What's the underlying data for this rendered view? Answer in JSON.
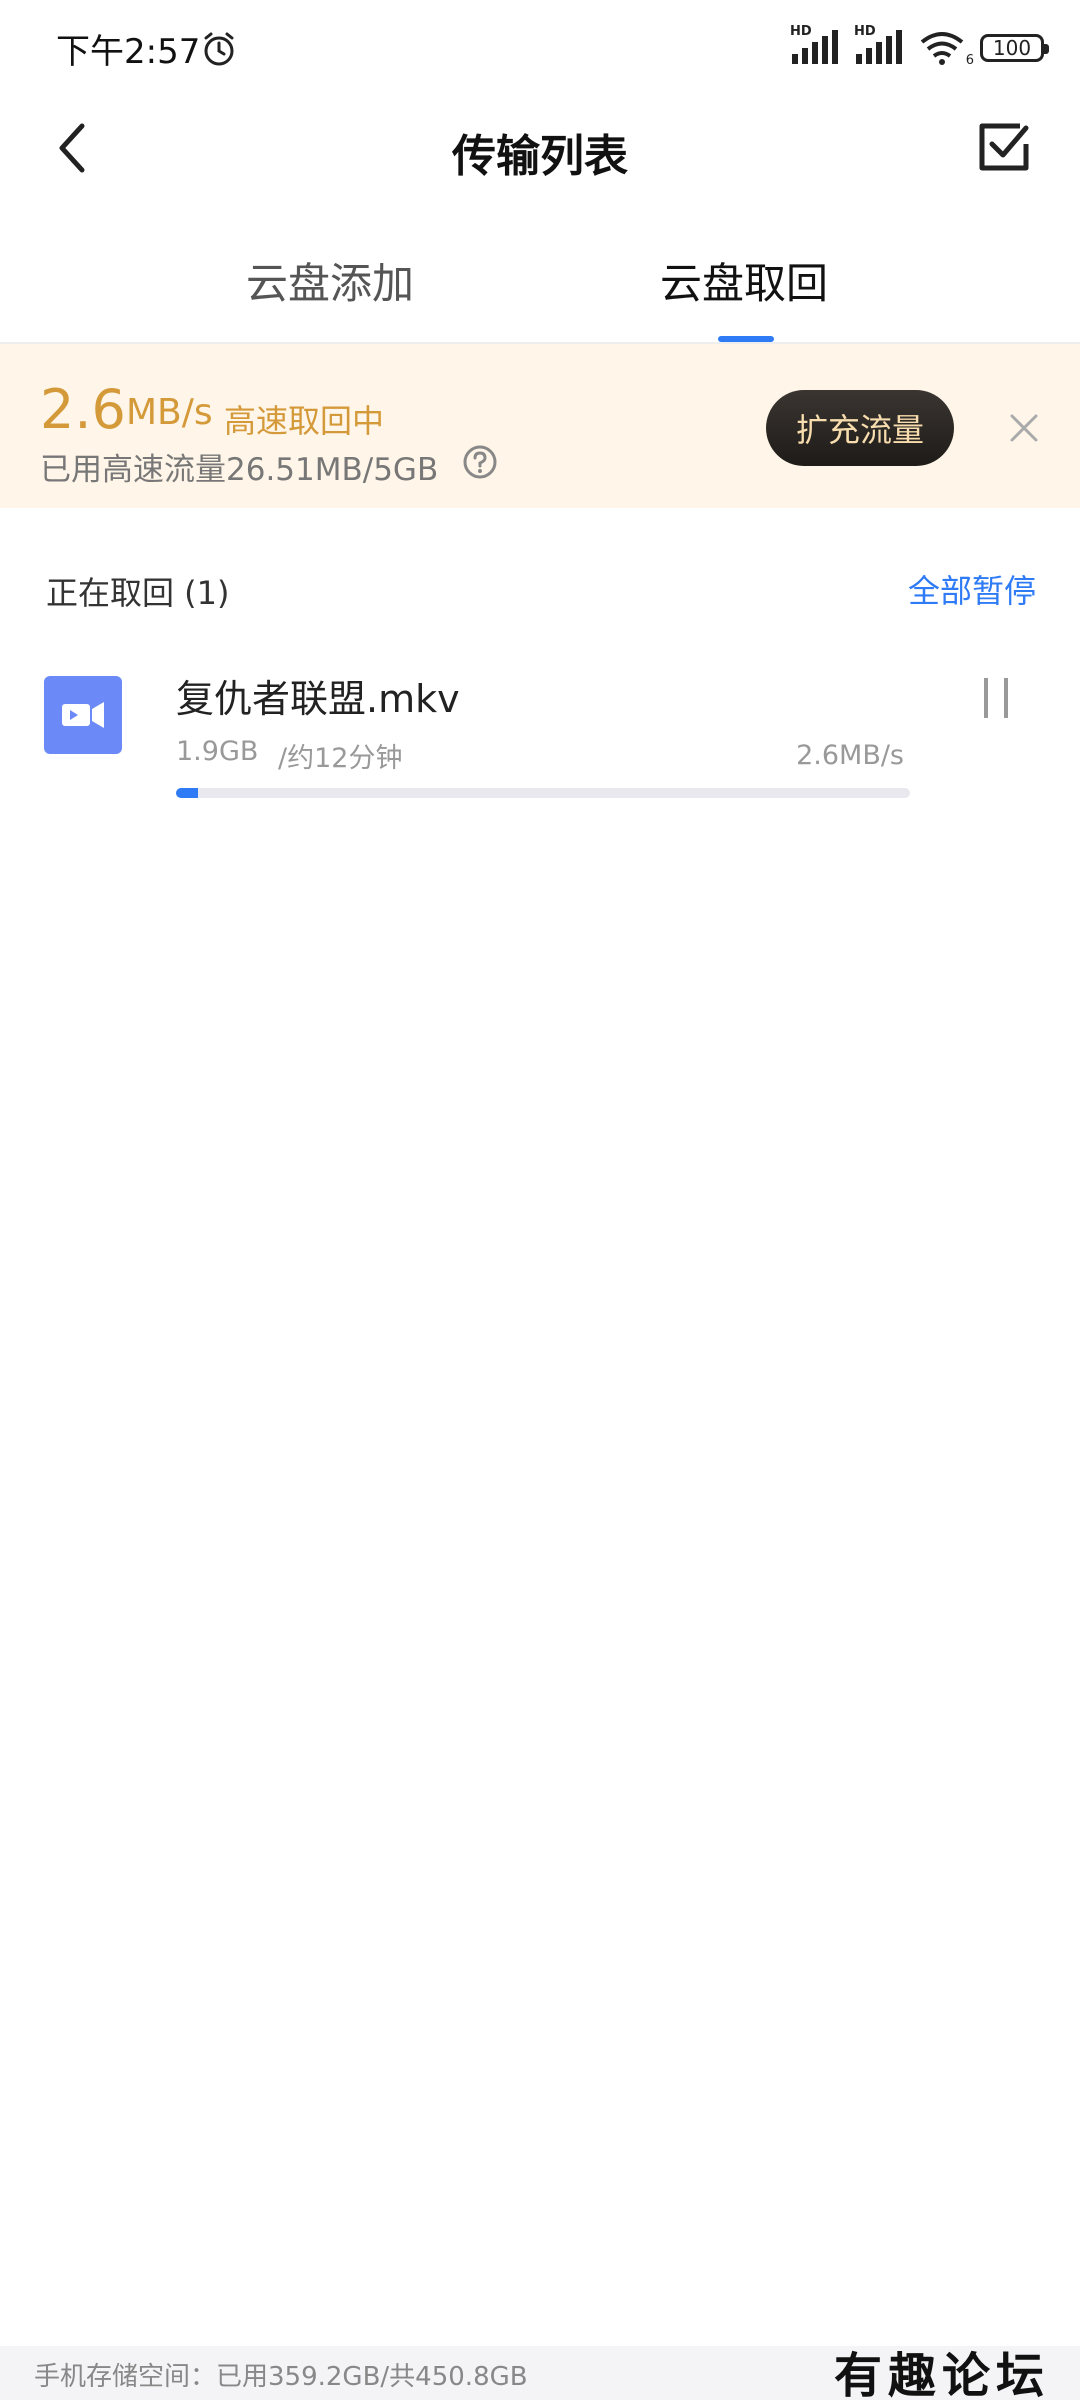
{
  "status_bar": {
    "time": "下午2:57",
    "signal1": "HD",
    "signal2": "HD",
    "wifi_label": "6",
    "battery": "100"
  },
  "header": {
    "title": "传输列表"
  },
  "tabs": [
    {
      "label": "云盘添加",
      "active": false
    },
    {
      "label": "云盘取回",
      "active": true
    }
  ],
  "banner": {
    "speed_value": "2.6",
    "speed_unit": "MB/s",
    "speed_status": "高速取回中",
    "usage": "已用高速流量26.51MB/5GB",
    "expand_button": "扩充流量"
  },
  "section": {
    "title": "正在取回 (1)",
    "pause_all": "全部暂停"
  },
  "file": {
    "name": "复仇者联盟.mkv",
    "size": "1.9GB",
    "eta": "/约12分钟",
    "speed": "2.6MB/s",
    "progress_percent": 3
  },
  "footer": {
    "storage": "手机存储空间：已用359.2GB/共450.8GB",
    "watermark": "有趣论坛"
  },
  "colors": {
    "accent": "#2f7bf5",
    "banner_bg": "#fff5e8",
    "banner_text": "#d49a3a",
    "file_icon": "#6b8af8"
  }
}
